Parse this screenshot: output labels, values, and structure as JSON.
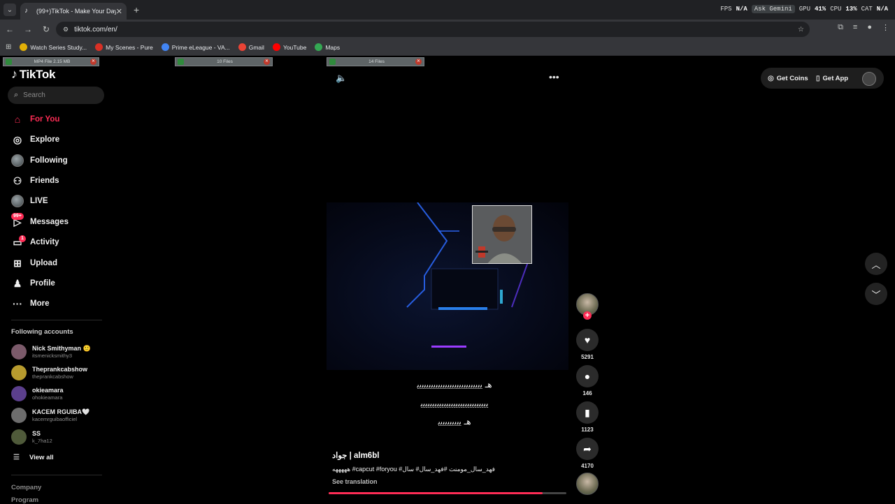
{
  "browser": {
    "tab_title": "(99+)TikTok - Make Your Day",
    "url": "tiktok.com/en/",
    "hud": {
      "fps_label": "FPS",
      "fps_value": "N/A",
      "gpu_label": "GPU",
      "gpu_value": "41%",
      "cpu_label": "CPU",
      "cpu_value": "13%",
      "cat_label": "CAT",
      "cat_value": "N/A",
      "ask_label": "Ask Gemini"
    },
    "bookmarks": [
      {
        "label": "Watch Series Study...",
        "color": "#e2b007"
      },
      {
        "label": "My Scenes - Pure",
        "color": "#d93025"
      },
      {
        "label": "Prime eLeague - VA...",
        "color": "#4285f4"
      },
      {
        "label": "Gmail",
        "color": "#ea4335"
      },
      {
        "label": "YouTube",
        "color": "#ff0000"
      },
      {
        "label": "Maps",
        "color": "#34a853"
      }
    ],
    "downloads": [
      "MP4 File 2.15 MB",
      "10 Files",
      "14 Files"
    ]
  },
  "sidebar": {
    "logo": "TikTok",
    "search_placeholder": "Search",
    "nav": [
      {
        "label": "For You",
        "icon": "home-icon"
      },
      {
        "label": "Explore",
        "icon": "compass-icon"
      },
      {
        "label": "Following",
        "icon": "following-avatar-icon"
      },
      {
        "label": "Friends",
        "icon": "friends-icon"
      },
      {
        "label": "LIVE",
        "icon": "live-icon"
      },
      {
        "label": "Messages",
        "icon": "messages-icon",
        "badge": "99+"
      },
      {
        "label": "Activity",
        "icon": "activity-icon",
        "badge": "1"
      },
      {
        "label": "Upload",
        "icon": "upload-icon"
      },
      {
        "label": "Profile",
        "icon": "profile-icon"
      },
      {
        "label": "More",
        "icon": "more-icon"
      }
    ],
    "following_title": "Following accounts",
    "following": [
      {
        "name": "Nick Smithyman 🙂",
        "handle": "itsmenicksmithy3",
        "color": "#7b5a6a"
      },
      {
        "name": "Theprankcabshow",
        "handle": "theprankcabshow",
        "color": "#b79b2e"
      },
      {
        "name": "okieamara",
        "handle": "ohokieamara",
        "color": "#5b3f8c"
      },
      {
        "name": "KACEM RGUIBA🤍",
        "handle": "kacemrguibaofficiel",
        "color": "#6d6d6d"
      },
      {
        "name": "SS",
        "handle": "k_7ha12",
        "color": "#4f5a3a"
      }
    ],
    "view_all": "View all",
    "footer": [
      "Company",
      "Program"
    ]
  },
  "video": {
    "overlay_lines": [
      "ﻫـ ﯾﯾﯾﯾﯾﯾﯾﯾﯾﯾﯾﯾﯾﯾﯾﯾﯾﯾﯾﯾﯾﯾﯾﯾﯾﯾﯾﯾ",
      "ﯾﯾﯾﯾﯾﯾﯾﯾﯾﯾﯾﯾﯾﯾﯾﯾﯾﯾﯾﯾﯾﯾﯾﯾﯾﯾﯾﯾﯾ",
      "ﻫـ ﯾﯾﯾﯾﯾﯾﯾﯾﯾﯾ"
    ],
    "author": "جواد | alm6bl",
    "caption": "هههههه #capcut #foryou #فهد_سال_مومنت #فهد_سال# سال",
    "see_translation": "See translation",
    "progress": 0.9
  },
  "actions": {
    "likes": "5291",
    "comments": "146",
    "saves": "1123",
    "shares": "4170"
  },
  "topbar": {
    "get_coins": "Get Coins",
    "get_app": "Get App"
  }
}
